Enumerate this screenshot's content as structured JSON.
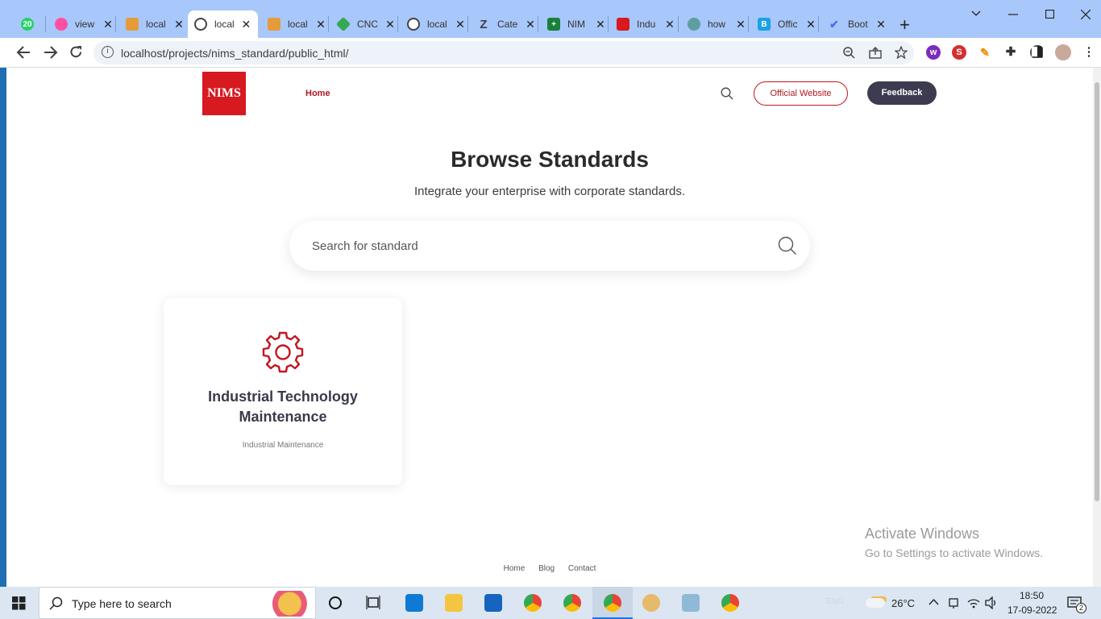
{
  "browser": {
    "tabs": [
      {
        "title": "",
        "badge": "20",
        "color": "#25d366"
      },
      {
        "title": "view",
        "color": "#ff4fa3"
      },
      {
        "title": "local",
        "color": "#e69b3a"
      },
      {
        "title": "local",
        "color": "#444444",
        "active": true
      },
      {
        "title": "local",
        "color": "#e69b3a"
      },
      {
        "title": "CNC",
        "color": "#34a853"
      },
      {
        "title": "local",
        "color": "#444444"
      },
      {
        "title": "Cate",
        "color": "#3c4043"
      },
      {
        "title": "NIM",
        "color": "#188038"
      },
      {
        "title": "Indu",
        "color": "#d71920"
      },
      {
        "title": "how",
        "color": "#5f9ea0"
      },
      {
        "title": "Offic",
        "color": "#1ba1e2"
      },
      {
        "title": "Boot",
        "color": "#4a6cf7"
      }
    ],
    "close_glyph": "✕",
    "new_tab_glyph": "+",
    "url": "localhost/projects/nims_standard/public_html/"
  },
  "site": {
    "logo_text": "NIMS",
    "nav": {
      "home": "Home"
    },
    "buttons": {
      "official": "Official Website",
      "feedback": "Feedback"
    },
    "accent": "#c3151d",
    "dark": "#3d3b50"
  },
  "hero": {
    "title": "Browse Standards",
    "subtitle": "Integrate your enterprise with corporate standards.",
    "search_placeholder": "Search for standard"
  },
  "cards": [
    {
      "title": "Industrial Technology Maintenance",
      "subtitle": "Industrial Maintenance",
      "icon": "gear-icon"
    }
  ],
  "footer": {
    "links": [
      "Home",
      "Blog",
      "Contact"
    ]
  },
  "watermark": {
    "line1": "Activate Windows",
    "line2": "Go to Settings to activate Windows."
  },
  "taskbar": {
    "search_placeholder": "Type here to search",
    "weather": "26°C",
    "lang": "ENG",
    "time": "18:50",
    "date": "17-09-2022",
    "notifications": "2"
  }
}
